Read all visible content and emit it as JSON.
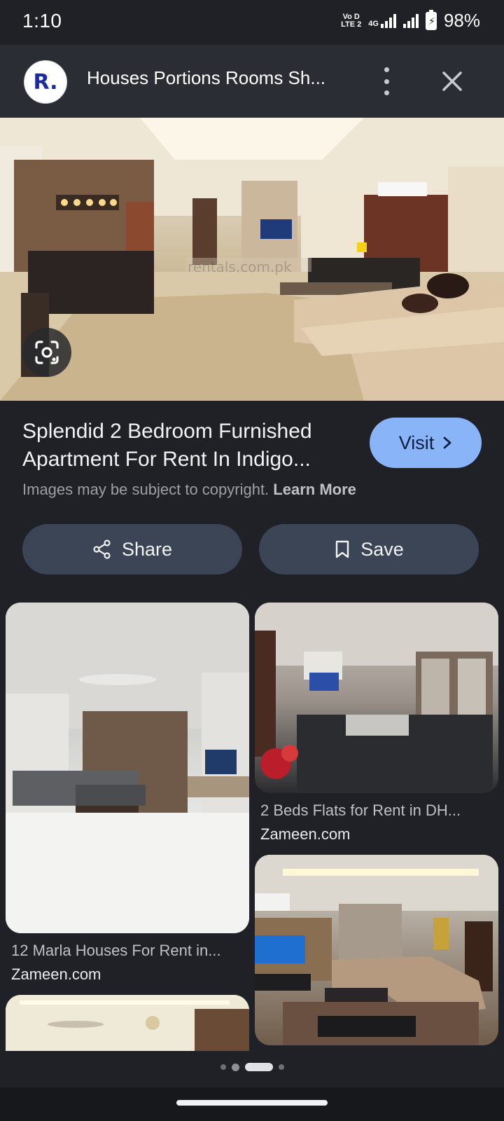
{
  "status_bar": {
    "time": "1:10",
    "network_badge_top": "Vo D",
    "network_badge_bottom": "LTE 2",
    "network_type": "4G",
    "battery_percent": "98%"
  },
  "header": {
    "site_initial": "R.",
    "title": "Houses Portions Rooms Sh..."
  },
  "hero": {
    "watermark": "rentals.com.pk"
  },
  "result": {
    "title_line1": "Splendid 2 Bedroom Furnished",
    "title_line2": "Apartment For Rent In Indigo...",
    "visit_label": "Visit",
    "copyright_text": "Images may be subject to copyright.",
    "learn_more": "Learn More",
    "share_label": "Share",
    "save_label": "Save"
  },
  "related": [
    {
      "title": "12 Marla Houses For Rent in...",
      "source": "Zameen.com"
    },
    {
      "title": "2 Beds Flats for Rent in DH...",
      "source": "Zameen.com"
    }
  ],
  "colors": {
    "background": "#1f2126",
    "visit_button": "#8ab4f8",
    "pill_button": "#3c4556"
  }
}
